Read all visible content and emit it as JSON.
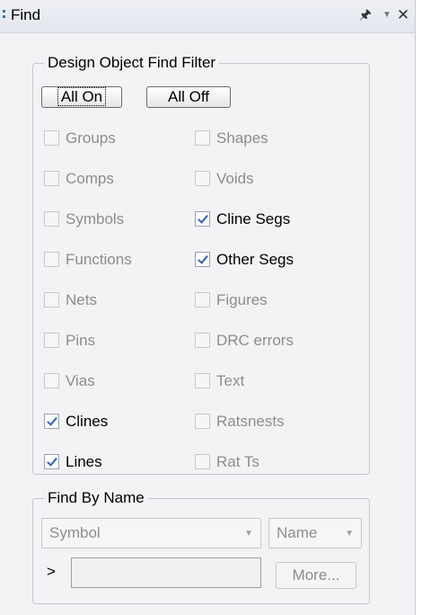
{
  "panel": {
    "title": "Find",
    "pin_icon": "pin-icon",
    "menu_icon": "dropdown-triangle-icon",
    "close_icon": "close-icon",
    "accent_color": "#3a6fb0"
  },
  "filter": {
    "legend": "Design Object Find Filter",
    "all_on_label": "All On",
    "all_off_label": "All Off",
    "left_column": [
      {
        "label": "Groups",
        "checked": false,
        "enabled": false
      },
      {
        "label": "Comps",
        "checked": false,
        "enabled": false
      },
      {
        "label": "Symbols",
        "checked": false,
        "enabled": false
      },
      {
        "label": "Functions",
        "checked": false,
        "enabled": false
      },
      {
        "label": "Nets",
        "checked": false,
        "enabled": false
      },
      {
        "label": "Pins",
        "checked": false,
        "enabled": false
      },
      {
        "label": "Vias",
        "checked": false,
        "enabled": false
      },
      {
        "label": "Clines",
        "checked": true,
        "enabled": true
      },
      {
        "label": "Lines",
        "checked": true,
        "enabled": true
      }
    ],
    "right_column": [
      {
        "label": "Shapes",
        "checked": false,
        "enabled": false
      },
      {
        "label": "Voids",
        "checked": false,
        "enabled": false
      },
      {
        "label": "Cline Segs",
        "checked": true,
        "enabled": true
      },
      {
        "label": "Other Segs",
        "checked": true,
        "enabled": true
      },
      {
        "label": "Figures",
        "checked": false,
        "enabled": false
      },
      {
        "label": "DRC errors",
        "checked": false,
        "enabled": false
      },
      {
        "label": "Text",
        "checked": false,
        "enabled": false
      },
      {
        "label": "Ratsnests",
        "checked": false,
        "enabled": false
      },
      {
        "label": "Rat Ts",
        "checked": false,
        "enabled": false
      }
    ]
  },
  "find_by_name": {
    "legend": "Find By Name",
    "type_value": "Symbol",
    "mode_value": "Name",
    "prefix": ">",
    "name_value": "",
    "more_label": "More..."
  }
}
